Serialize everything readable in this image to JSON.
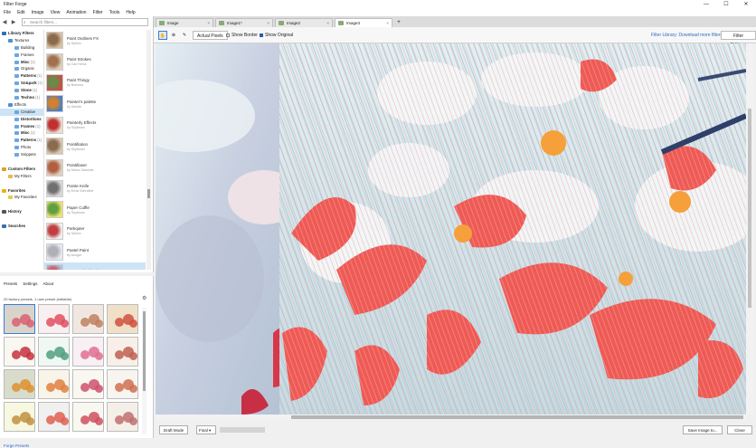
{
  "app": {
    "title": "Filter Forge"
  },
  "menu": [
    "File",
    "Edit",
    "Image",
    "View",
    "Animation",
    "Filter",
    "Tools",
    "Help"
  ],
  "window_controls": {
    "minimize": "—",
    "maximize": "☐",
    "close": "✕"
  },
  "search": {
    "placeholder": "Search filters..."
  },
  "tree": [
    {
      "label": "Library Filters",
      "count": "",
      "level": 0,
      "bold": true,
      "color": "#2e6fc0"
    },
    {
      "label": "Textures",
      "count": "",
      "level": 1,
      "bold": false,
      "color": "#4a8fd8"
    },
    {
      "label": "Building",
      "count": "",
      "level": 2,
      "bold": false,
      "color": "#6aa7e2"
    },
    {
      "label": "Frames",
      "count": "",
      "level": 2,
      "bold": false,
      "color": "#6aa7e2"
    },
    {
      "label": "Misc",
      "count": "(1)",
      "level": 2,
      "bold": true,
      "color": "#6aa7e2"
    },
    {
      "label": "Organic",
      "count": "",
      "level": 2,
      "bold": false,
      "color": "#6aa7e2"
    },
    {
      "label": "Patterns",
      "count": "(1)",
      "level": 2,
      "bold": true,
      "color": "#6aa7e2"
    },
    {
      "label": "Sn&park",
      "count": "(1)",
      "level": 2,
      "bold": true,
      "color": "#6aa7e2"
    },
    {
      "label": "Stone",
      "count": "(1)",
      "level": 2,
      "bold": true,
      "color": "#6aa7e2"
    },
    {
      "label": "Techno",
      "count": "(1)",
      "level": 2,
      "bold": true,
      "color": "#6aa7e2"
    },
    {
      "label": "Effects",
      "count": "",
      "level": 1,
      "bold": false,
      "color": "#4a8fd8"
    },
    {
      "label": "Creative",
      "count": "",
      "level": 2,
      "bold": false,
      "color": "#6aa7e2",
      "selected": true
    },
    {
      "label": "Distortions",
      "count": "",
      "level": 2,
      "bold": true,
      "color": "#6aa7e2"
    },
    {
      "label": "Frames",
      "count": "(1)",
      "level": 2,
      "bold": true,
      "color": "#6aa7e2"
    },
    {
      "label": "Misc",
      "count": "(1)",
      "level": 2,
      "bold": true,
      "color": "#6aa7e2"
    },
    {
      "label": "Patterns",
      "count": "(1)",
      "level": 2,
      "bold": true,
      "color": "#6aa7e2"
    },
    {
      "label": "Photo",
      "count": "",
      "level": 2,
      "bold": false,
      "color": "#6aa7e2"
    },
    {
      "label": "Snippets",
      "count": "",
      "level": 2,
      "bold": false,
      "color": "#6aa7e2"
    },
    {
      "label": "",
      "count": "",
      "level": 0,
      "bold": false,
      "color": ""
    },
    {
      "label": "Custom Filters",
      "count": "",
      "level": 0,
      "bold": true,
      "color": "#e0a020"
    },
    {
      "label": "My Filters",
      "count": "",
      "level": 1,
      "bold": false,
      "color": "#e8b84a"
    },
    {
      "label": "",
      "count": "",
      "level": 0,
      "bold": false,
      "color": ""
    },
    {
      "label": "Favorites",
      "count": "",
      "level": 0,
      "bold": true,
      "color": "#e6b800"
    },
    {
      "label": "My Favorites",
      "count": "",
      "level": 1,
      "bold": false,
      "color": "#e8c94a"
    },
    {
      "label": "",
      "count": "",
      "level": 0,
      "bold": false,
      "color": ""
    },
    {
      "label": "History",
      "count": "",
      "level": 0,
      "bold": true,
      "color": "#555555"
    },
    {
      "label": "",
      "count": "",
      "level": 0,
      "bold": false,
      "color": ""
    },
    {
      "label": "Searches",
      "count": "",
      "level": 0,
      "bold": true,
      "color": "#3a6fb0"
    }
  ],
  "filters": [
    {
      "name": "Paint Outlines FX",
      "author": "by Sphinx",
      "c1": "#8a6a4a",
      "c2": "#d8c0a0"
    },
    {
      "name": "Paint Strokes",
      "author": "by Carl Heinz",
      "c1": "#a07050",
      "c2": "#e0d0b8"
    },
    {
      "name": "Paint Thingy",
      "author": "by Brancha",
      "c1": "#6a8a4a",
      "c2": "#c85040"
    },
    {
      "name": "Painter's palette",
      "author": "by Davide",
      "c1": "#d08030",
      "c2": "#4a80c0"
    },
    {
      "name": "Painterly Effects",
      "author": "by Skybeam",
      "c1": "#c03030",
      "c2": "#e8e0d0"
    },
    {
      "name": "Pointillation",
      "author": "by Skybeam",
      "c1": "#8a6a50",
      "c2": "#d8c8b0"
    },
    {
      "name": "Pointillaser",
      "author": "by Marco Sassiner",
      "c1": "#b06040",
      "c2": "#e0d0c0"
    },
    {
      "name": "Pointe Knife",
      "author": "by Ernst Schreiber",
      "c1": "#707070",
      "c2": "#d8d8d8"
    },
    {
      "name": "Paper Cuffle",
      "author": "by Skybeam",
      "c1": "#60a040",
      "c2": "#f0e070"
    },
    {
      "name": "Parkquter",
      "author": "by Sphinx",
      "c1": "#c04040",
      "c2": "#f0f0f0"
    },
    {
      "name": "Pastel Paint",
      "author": "by Ansgar",
      "c1": "#b0b0b8",
      "c2": "#e8e8ee"
    },
    {
      "name": "Patterned Dithering",
      "author": "by Skybeam",
      "c1": "#d06070",
      "c2": "#a0c8e0",
      "selected": true
    }
  ],
  "panel_tabs": [
    "Presets",
    "Settings",
    "About"
  ],
  "presets_info": "20 factory presets, 1 user preset (editable)",
  "presets": [
    {
      "bg": "#d8d4cc",
      "c": "#d86070"
    },
    {
      "bg": "#f8f0f0",
      "c": "#e05060"
    },
    {
      "bg": "#f0e8e0",
      "c": "#c08060"
    },
    {
      "bg": "#f0e0c8",
      "c": "#d05040"
    },
    {
      "bg": "#f8f8f0",
      "c": "#c83040"
    },
    {
      "bg": "#f0f8f4",
      "c": "#50a080"
    },
    {
      "bg": "#f8f0f4",
      "c": "#e07090"
    },
    {
      "bg": "#f8f0e8",
      "c": "#c06050"
    },
    {
      "bg": "#d8dccc",
      "c": "#e09030"
    },
    {
      "bg": "#f8f4e8",
      "c": "#e08040"
    },
    {
      "bg": "#f8f8f0",
      "c": "#d05070"
    },
    {
      "bg": "#f8f4f0",
      "c": "#d07050"
    },
    {
      "bg": "#f8f8e0",
      "c": "#c09040"
    },
    {
      "bg": "#f0f0f0",
      "c": "#e06050"
    },
    {
      "bg": "#f8f8f0",
      "c": "#d05060"
    },
    {
      "bg": "#f4f0e8",
      "c": "#c07070"
    }
  ],
  "forge_presets_link": "Forge Presets",
  "tabs": [
    {
      "label": "Image",
      "active": false
    },
    {
      "label": "Image1*",
      "active": false
    },
    {
      "label": "Image2",
      "active": false
    },
    {
      "label": "Image3",
      "active": true
    }
  ],
  "toolbar": {
    "actual_pixels": "Actual Pixels",
    "show_border": "Show Border",
    "show_original": "Show Original",
    "library_link": "Filter Library: Download more filters",
    "filter_editor": "Filter Editor..."
  },
  "bottom": {
    "draft_mode": "Draft Mode",
    "quality": "Final",
    "save_image": "Save Image to...",
    "close": "Close"
  },
  "colors": {
    "accent": "#2b6cc4",
    "selection": "#cde3f7"
  }
}
